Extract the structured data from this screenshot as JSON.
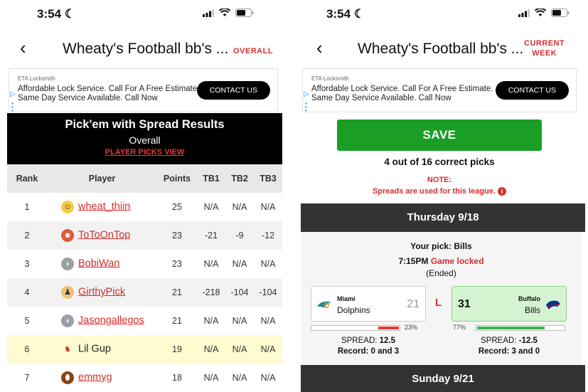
{
  "status_time": "3:54",
  "ad": {
    "advertiser": "ETA Locksmith",
    "text": "Affordable Lock Service. Call For A Free Estimate. Same Day Service Available. Call Now",
    "cta": "CONTACT US"
  },
  "left": {
    "title": "Wheaty's Football bb's ...",
    "nav_link": "OVERALL",
    "results_title": "Pick'em with Spread Results",
    "results_subtitle": "Overall",
    "picks_link": "PLAYER PICKS VIEW",
    "columns": [
      "Rank",
      "Player",
      "Points",
      "TB1",
      "TB2",
      "TB3"
    ],
    "rows": [
      {
        "rank": "1",
        "player": "wheat_thiin",
        "points": "25",
        "tb1": "N/A",
        "tb2": "N/A",
        "tb3": "N/A"
      },
      {
        "rank": "2",
        "player": "ToToOnTop",
        "points": "23",
        "tb1": "-21",
        "tb2": "-9",
        "tb3": "-12"
      },
      {
        "rank": "3",
        "player": "BobiWan",
        "points": "23",
        "tb1": "N/A",
        "tb2": "N/A",
        "tb3": "N/A"
      },
      {
        "rank": "4",
        "player": "GirthyPick",
        "points": "21",
        "tb1": "-218",
        "tb2": "-104",
        "tb3": "-104"
      },
      {
        "rank": "5",
        "player": "Jasongallegos",
        "points": "21",
        "tb1": "N/A",
        "tb2": "N/A",
        "tb3": "N/A"
      },
      {
        "rank": "6",
        "player": "Lil Gup",
        "points": "19",
        "tb1": "N/A",
        "tb2": "N/A",
        "tb3": "N/A"
      },
      {
        "rank": "7",
        "player": "emmyg",
        "points": "18",
        "tb1": "N/A",
        "tb2": "N/A",
        "tb3": "N/A"
      }
    ]
  },
  "right": {
    "title": "Wheaty's Football bb's ...",
    "nav_link_line1": "CURRENT",
    "nav_link_line2": "WEEK",
    "save_label": "SAVE",
    "correct_text": "4 out of 16 correct picks",
    "note_label": "NOTE:",
    "note_text": "Spreads are used for this league.",
    "day1": "Thursday 9/18",
    "your_pick": "Your pick: Bills",
    "game_time": "7:15PM",
    "game_status": "Game locked",
    "game_ended": "(Ended)",
    "away": {
      "city": "Miami",
      "name": "Dolphins",
      "score": "21",
      "pick_pct": "23%",
      "spread_label": "SPREAD:",
      "spread": "12.5",
      "record": "Record: 0 and 3"
    },
    "home": {
      "city": "Buffalo",
      "name": "Bills",
      "score": "31",
      "pick_pct": "77%",
      "spread_label": "SPREAD:",
      "spread": "-12.5",
      "record": "Record: 3 and 0"
    },
    "result_letter": "L",
    "day2": "Sunday 9/21"
  },
  "colors": {
    "accent_red": "#d32f2f",
    "save_green": "#1a9e25",
    "winner_bg": "#d4f3d0"
  }
}
